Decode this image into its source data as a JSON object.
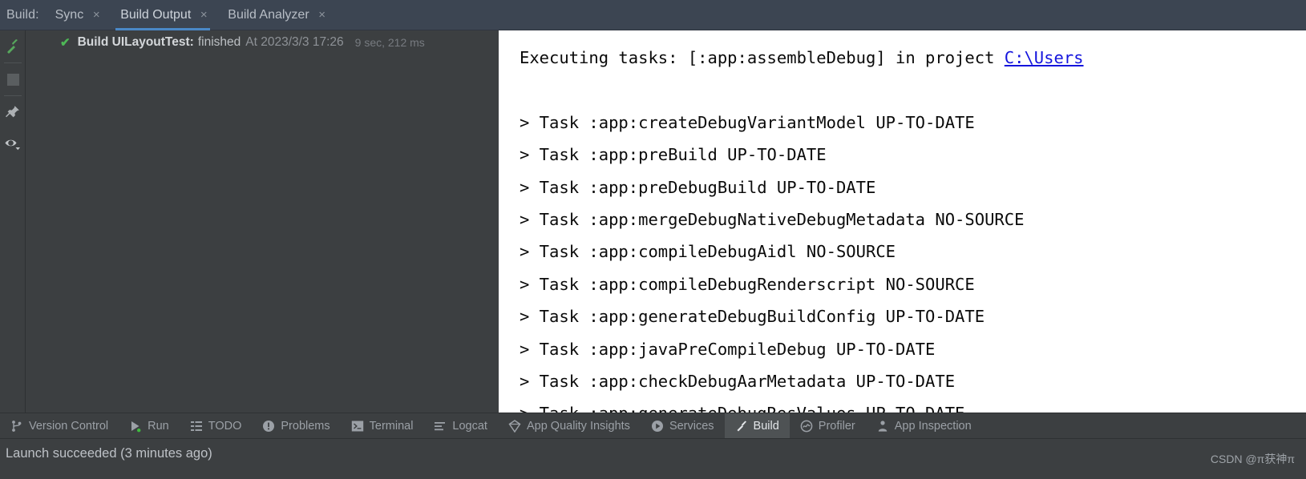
{
  "tabbar": {
    "label": "Build:",
    "close_glyph": "×",
    "tabs": [
      {
        "label": "Sync",
        "active": false,
        "closable": true
      },
      {
        "label": "Build Output",
        "active": true,
        "closable": true
      },
      {
        "label": "Build Analyzer",
        "active": false,
        "closable": true
      }
    ],
    "accent_color": "#4a88c7",
    "background_color": "#3c4552"
  },
  "rail": {
    "buttons": [
      {
        "icon": "hammer-icon",
        "name": "rerun-build-button"
      },
      {
        "icon": "stop-icon",
        "name": "stop-build-button"
      },
      {
        "icon": "pin-icon",
        "name": "pin-tab-button"
      },
      {
        "icon": "eye-icon",
        "name": "filter-view-button"
      }
    ]
  },
  "build_status": {
    "check_glyph": "✔",
    "check_color": "#4eb856",
    "title": "Build UILayoutTest:",
    "result": "finished",
    "timestamp": "At 2023/3/3 17:26",
    "duration": "9 sec, 212 ms"
  },
  "console": {
    "background_color": "#ffffff",
    "text_color": "#0a0a0a",
    "link_color": "#1414dd",
    "lines": [
      {
        "type": "text",
        "pre": "Executing tasks: [:app:assembleDebug] in project ",
        "link": "C:\\Users"
      },
      {
        "type": "blank"
      },
      {
        "type": "text",
        "pre": "> Task :app:createDebugVariantModel UP-TO-DATE"
      },
      {
        "type": "text",
        "pre": "> Task :app:preBuild UP-TO-DATE"
      },
      {
        "type": "text",
        "pre": "> Task :app:preDebugBuild UP-TO-DATE"
      },
      {
        "type": "text",
        "pre": "> Task :app:mergeDebugNativeDebugMetadata NO-SOURCE"
      },
      {
        "type": "text",
        "pre": "> Task :app:compileDebugAidl NO-SOURCE"
      },
      {
        "type": "text",
        "pre": "> Task :app:compileDebugRenderscript NO-SOURCE"
      },
      {
        "type": "text",
        "pre": "> Task :app:generateDebugBuildConfig UP-TO-DATE"
      },
      {
        "type": "text",
        "pre": "> Task :app:javaPreCompileDebug UP-TO-DATE"
      },
      {
        "type": "text",
        "pre": "> Task :app:checkDebugAarMetadata UP-TO-DATE"
      },
      {
        "type": "text",
        "pre": "> Task :app:generateDebugResValues UP-TO-DATE"
      }
    ]
  },
  "toolwindows": [
    {
      "label": "Version Control",
      "icon": "branch-icon",
      "active": false
    },
    {
      "label": "Run",
      "icon": "run-icon",
      "active": false
    },
    {
      "label": "TODO",
      "icon": "todo-icon",
      "active": false
    },
    {
      "label": "Problems",
      "icon": "problems-icon",
      "active": false
    },
    {
      "label": "Terminal",
      "icon": "terminal-icon",
      "active": false
    },
    {
      "label": "Logcat",
      "icon": "logcat-icon",
      "active": false
    },
    {
      "label": "App Quality Insights",
      "icon": "gem-icon",
      "active": false
    },
    {
      "label": "Services",
      "icon": "services-icon",
      "active": false
    },
    {
      "label": "Build",
      "icon": "hammer-icon",
      "active": true
    },
    {
      "label": "Profiler",
      "icon": "profiler-icon",
      "active": false
    },
    {
      "label": "App Inspection",
      "icon": "inspection-icon",
      "active": false
    }
  ],
  "statusbar": {
    "message": "Launch succeeded (3 minutes ago)",
    "watermark": "CSDN @π获神π"
  }
}
